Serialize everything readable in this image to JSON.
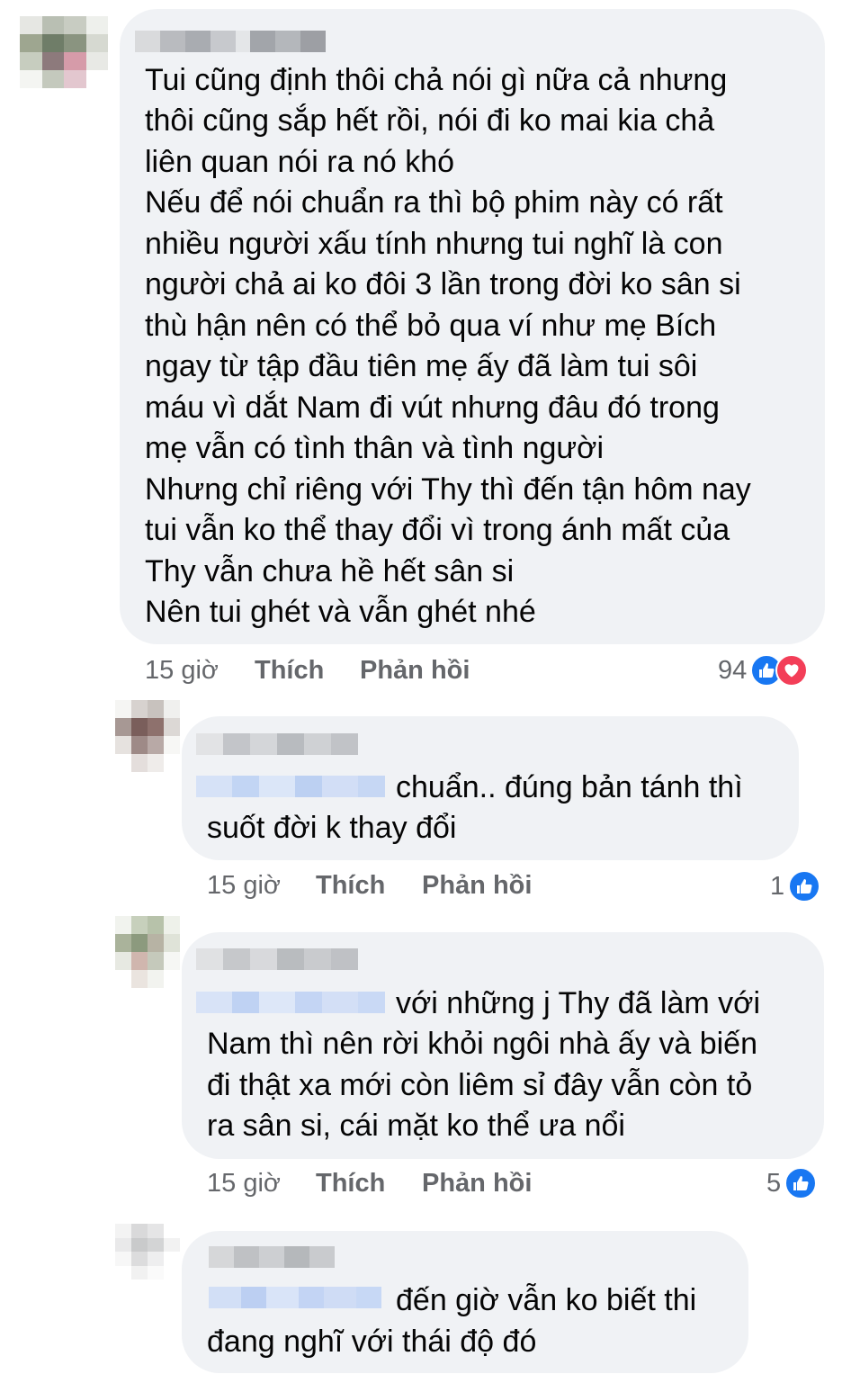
{
  "comments": [
    {
      "lines": [
        "Tui cũng định thôi chả nói gì nữa cả nhưng",
        "thôi cũng sắp hết rồi, nói đi ko mai kia chả",
        "liên quan nói ra nó khó",
        "Nếu để nói chuẩn ra thì bộ phim này có rất",
        "nhiều người xấu tính nhưng tui nghĩ là con",
        "người chả ai ko đôi 3 lần trong đời ko sân si",
        "thù hận nên có thể bỏ qua ví như mẹ Bích",
        "ngay từ tập đầu tiên mẹ ấy đã làm tui sôi",
        "máu vì dắt Nam đi vút nhưng đâu đó trong",
        "mẹ vẫn có tình thân và tình người",
        "Nhưng chỉ riêng với Thy thì đến tận hôm nay",
        "tui vẫn ko thể thay đổi vì trong ánh mất của",
        "Thy vẫn chưa hề hết sân si",
        "Nên tui ghét và vẫn ghét nhé"
      ],
      "time": "15 giờ",
      "like_label": "Thích",
      "reply_label": "Phản hồi",
      "reaction_count": "94",
      "reactions": [
        "like-icon",
        "love-icon"
      ]
    },
    {
      "lines": [
        "chuẩn.. đúng bản tánh thì",
        "suốt đời k thay đổi"
      ],
      "time": "15 giờ",
      "like_label": "Thích",
      "reply_label": "Phản hồi",
      "reaction_count": "1",
      "reactions": [
        "like-icon"
      ]
    },
    {
      "lines": [
        "với những j Thy đã làm với",
        "Nam thì nên rời khỏi ngôi nhà ấy và biến",
        "đi thật xa mới còn liêm sỉ đây vẫn còn tỏ",
        "ra sân si, cái mặt ko thể ưa nổi"
      ],
      "time": "15 giờ",
      "like_label": "Thích",
      "reply_label": "Phản hồi",
      "reaction_count": "5",
      "reactions": [
        "like-icon"
      ]
    },
    {
      "lines": [
        "đến giờ vẫn ko biết thi",
        "đang nghĩ với thái độ đó"
      ]
    }
  ],
  "colors": {
    "bubble": "#f0f2f5",
    "meta_text": "#65676b",
    "like_blue": "#1877f2",
    "love_red": "#f33e58"
  }
}
